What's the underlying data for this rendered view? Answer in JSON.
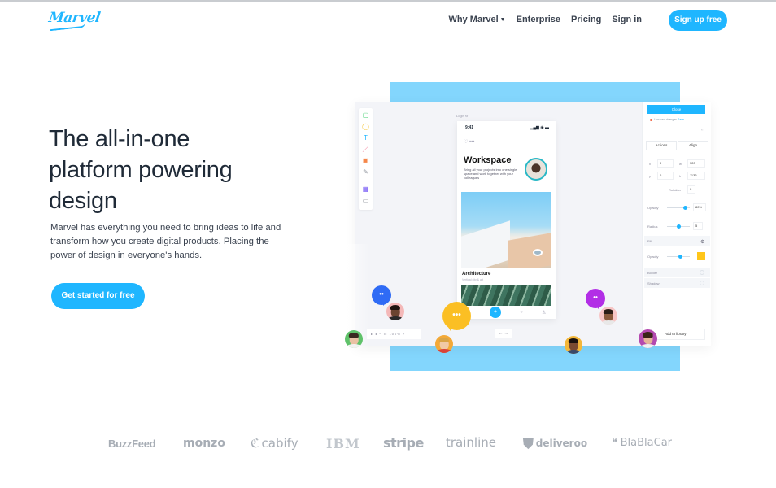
{
  "header": {
    "logo": "Marvel",
    "nav": [
      {
        "label": "Why Marvel",
        "has_dropdown": true
      },
      {
        "label": "Enterprise"
      },
      {
        "label": "Pricing"
      },
      {
        "label": "Sign in"
      }
    ],
    "signup_label": "Sign up free"
  },
  "hero": {
    "title_lines": [
      "The all-in-one",
      "platform powering",
      "design"
    ],
    "subtitle_lines": [
      "Marvel has everything you need to bring ideas to life and",
      "transform how you create digital products. Placing the",
      "power of design in everyone's hands."
    ],
    "cta_label": "Get started for free"
  },
  "mockup": {
    "frame_label": "Login ⚙",
    "tools": [
      {
        "icon": "rectangle-icon",
        "glyph": "▢",
        "color": "#3ecf6e"
      },
      {
        "icon": "oval-icon",
        "glyph": "◯",
        "color": "#f5c842"
      },
      {
        "icon": "text-icon",
        "glyph": "T",
        "color": "#1fb6ff"
      },
      {
        "icon": "line-icon",
        "glyph": "／",
        "color": "#f06a8a"
      },
      {
        "icon": "image-icon",
        "glyph": "▣",
        "color": "#f5874a"
      },
      {
        "icon": "pen-icon",
        "glyph": "✎",
        "color": "#8a8f98"
      },
      {
        "icon": "components-icon",
        "glyph": "▦",
        "color": "#6b4cf5"
      },
      {
        "icon": "device-icon",
        "glyph": "▭",
        "color": "#8a8f98"
      }
    ],
    "phone": {
      "time": "9:41",
      "signal": "▂▄▆ ◉ ▬",
      "icons_row": "♡ •••",
      "title": "Workspace",
      "description": "Bring all your projects into one single space and work together with your colleagues",
      "card_title": "Architecture",
      "card_subtitle": "Vertical city & art",
      "tabbar": [
        "♙",
        "+",
        "○",
        "♙"
      ]
    },
    "panel": {
      "close_label": "Close",
      "unsaved_text": "Unsaved changes",
      "save_link": "Save",
      "arrows": "‹ ›",
      "segments": [
        "Actions",
        "Align"
      ],
      "fields": [
        {
          "label": "x",
          "value": "0"
        },
        {
          "label": "w",
          "value": "320"
        },
        {
          "label": "y",
          "value": "0"
        },
        {
          "label": "h",
          "value": "1136"
        }
      ],
      "rotation_label": "Rotation",
      "rotation_value": "0",
      "opacity_label": "Opacity",
      "opacity_value": "80%",
      "opacity_level": 0.8,
      "radius_label": "Radius",
      "radius_value": "5",
      "radius_level": 0.5,
      "fill_label": "Fill",
      "fill_opacity_label": "Opacity",
      "fill_opacity_level": 0.6,
      "fill_color": "#ffc61a",
      "border_label": "Border",
      "shadow_label": "Shadow",
      "library_label": "Add to library"
    },
    "zoombar": "▸ ◂ − ▭ 100% +",
    "undobar": "← →",
    "bubbles": {
      "blue": "••",
      "yellow": "•••",
      "purple": "••"
    }
  },
  "logos": [
    "BuzzFeed",
    "monzo",
    "cabify",
    "IBM",
    "stripe",
    "trainline",
    "deliveroo",
    "BlaBlaCar"
  ],
  "colors": {
    "accent": "#1fb6ff",
    "text_dark": "#1f2a37",
    "illustration_blue": "#83d6fd",
    "logo_gray": "#a7adb5"
  }
}
